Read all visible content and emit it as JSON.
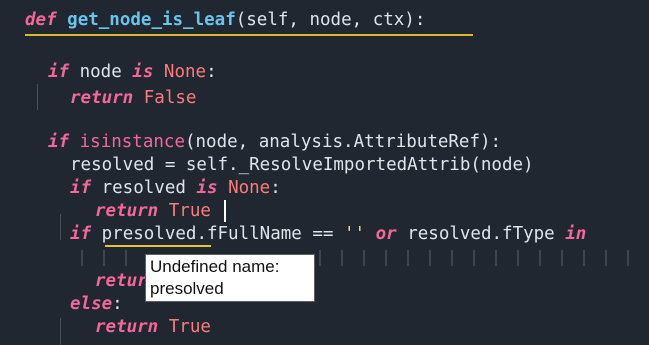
{
  "editor": {
    "lines": [
      {
        "def_kw": "def",
        "fn_name": "get_node_is_leaf",
        "params": "(self, node, ctx):"
      },
      {
        "kw1": "if",
        "t1": " node ",
        "kw2": "is",
        "t2": " ",
        "const": "None",
        "t3": ":"
      },
      {
        "kw": "return",
        "const": "False"
      },
      {
        "kw": "if",
        "builtin": "isinstance",
        "t1": "(node, analysis.",
        "t2": "AttributeRef",
        "t3": "):"
      },
      {
        "text": "resolved = self._ResolveImportedAttrib(node)"
      },
      {
        "kw1": "if",
        "t1": " resolved ",
        "kw2": "is",
        "t2": " ",
        "const": "None",
        "t3": ":"
      },
      {
        "kw": "return",
        "const": "True"
      },
      {
        "kw": "if",
        "undef": "presolved",
        "t1": ".fFullName == ",
        "str": "''",
        "kw2": "or",
        "t2": " resolved.fType ",
        "kw3": "in"
      },
      {
        "kw": "retur"
      },
      {
        "kw": "else",
        "t1": ":"
      },
      {
        "kw": "return",
        "const": "True"
      }
    ]
  },
  "tooltip": {
    "line1": "Undefined name:",
    "line2": "presolved"
  },
  "colors": {
    "background": "#212731",
    "keyword": "#f4679a",
    "function": "#67c5ec",
    "constant": "#fa7c7c",
    "string": "#ffd866",
    "error_underline": "#e7c33a"
  }
}
